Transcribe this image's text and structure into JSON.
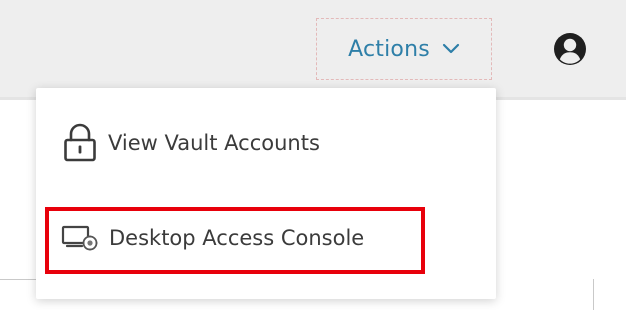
{
  "header": {
    "actions_label": "Actions",
    "actions_icon": "chevron-down-icon",
    "account_icon": "user-circle-icon"
  },
  "menu": {
    "items": [
      {
        "label": "View Vault Accounts",
        "icon": "lock-icon"
      },
      {
        "label": "Desktop Access Console",
        "icon": "desktop-console-icon",
        "highlighted": true
      }
    ]
  },
  "colors": {
    "header_bg": "#eeeeee",
    "actions_text": "#2e7fa8",
    "menu_text": "#3b3b3b",
    "highlight_border": "#e8000b",
    "dashed_focus": "#e3b9b9"
  }
}
